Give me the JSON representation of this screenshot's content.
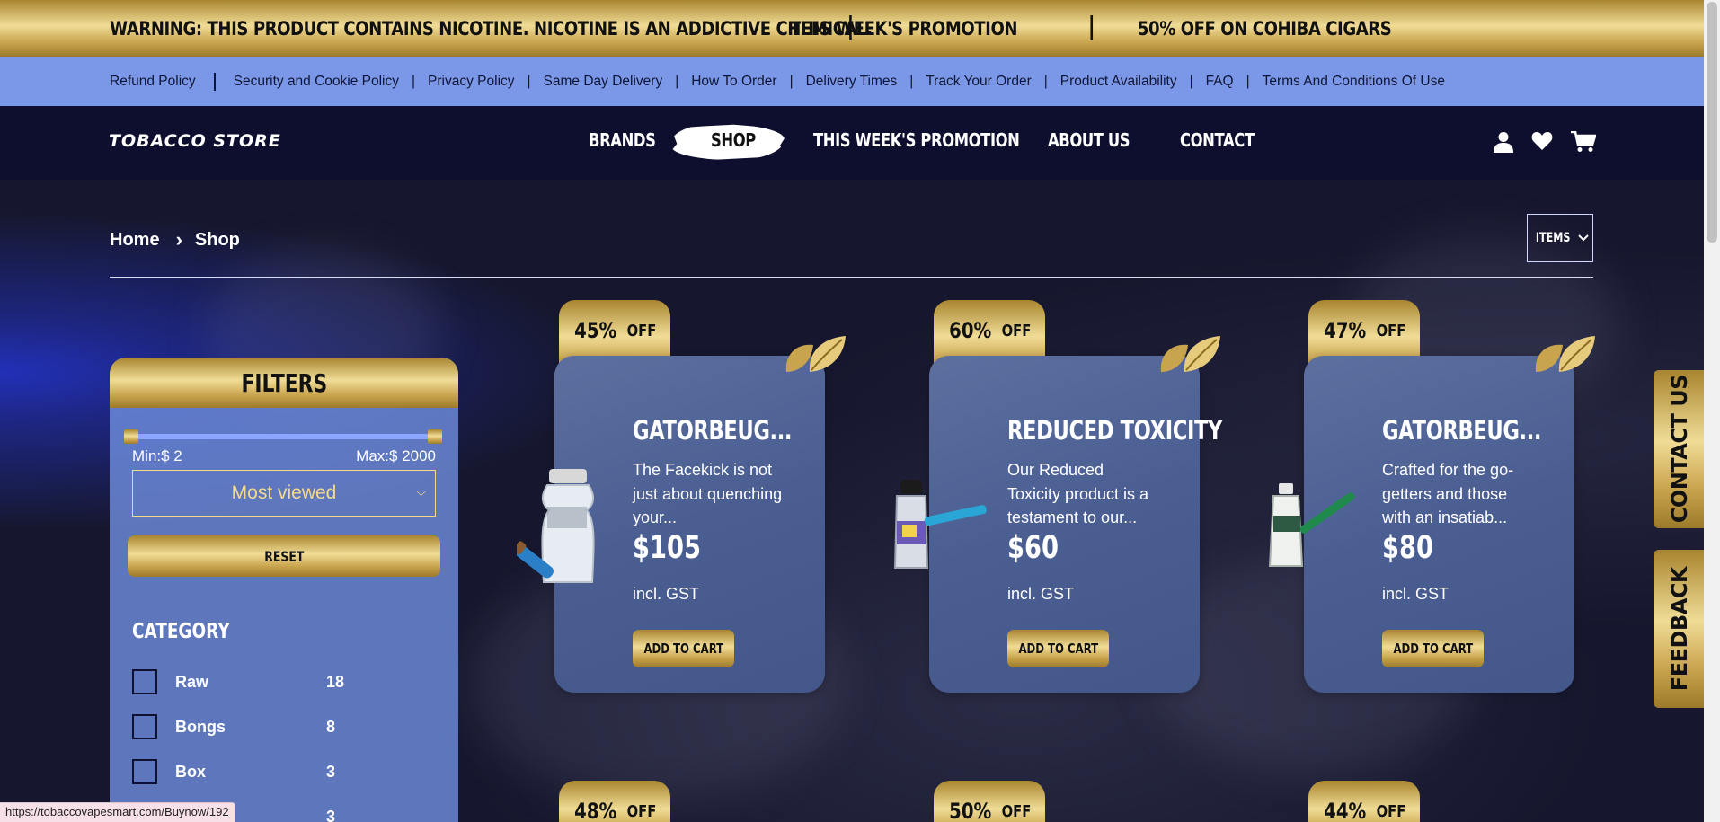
{
  "warning_bar": {
    "warning": "WARNING: THIS PRODUCT CONTAINS NICOTINE. NICOTINE IS AN ADDICTIVE CHEMICAL.",
    "promo_title": "THIS WEEK'S PROMOTION",
    "promo_offer": "50% OFF ON COHIBA CIGARS"
  },
  "top_links": [
    "Refund Policy",
    "Security and Cookie Policy",
    "Privacy Policy",
    "Same Day Delivery",
    "How To Order",
    "Delivery Times",
    "Track Your Order",
    "Product Availability",
    "FAQ",
    "Terms And Conditions Of Use"
  ],
  "nav": {
    "logo": "TOBACCO STORE",
    "items": [
      "BRANDS",
      "SHOP",
      "THIS WEEK'S PROMOTION",
      "ABOUT US",
      "CONTACT"
    ],
    "active": "SHOP",
    "icons": [
      "user-icon",
      "heart-icon",
      "cart-icon"
    ]
  },
  "breadcrumb": {
    "home": "Home",
    "current": "Shop"
  },
  "items_select": {
    "label": "ITEMS"
  },
  "filters": {
    "title": "FILTERS",
    "price_min": "Min:$ 2",
    "price_max": "Max:$ 2000",
    "sort_value": "Most viewed",
    "reset_label": "RESET",
    "category_title": "CATEGORY",
    "categories": [
      {
        "name": "Raw",
        "count": "18"
      },
      {
        "name": "Bongs",
        "count": "8"
      },
      {
        "name": "Box",
        "count": "3"
      },
      {
        "name": "",
        "count": "3"
      }
    ]
  },
  "products": [
    {
      "discount_value": "45%",
      "discount_suffix": "OFF",
      "title": "GATORBEUG...",
      "desc": "The Facekick is not just about quenching your...",
      "price": "$105",
      "gst": "incl. GST",
      "button": "ADD TO CART"
    },
    {
      "discount_value": "60%",
      "discount_suffix": "OFF",
      "title": "REDUCED TOXICITY",
      "desc": "Our Reduced Toxicity product is a testament to our...",
      "price": "$60",
      "gst": "incl. GST",
      "button": "ADD TO CART"
    },
    {
      "discount_value": "47%",
      "discount_suffix": "OFF",
      "title": "GATORBEUG...",
      "desc": "Crafted for the go-getters and those with an insatiab...",
      "price": "$80",
      "gst": "incl. GST",
      "button": "ADD TO CART"
    }
  ],
  "next_row_discounts": [
    {
      "value": "48%",
      "suffix": "OFF"
    },
    {
      "value": "50%",
      "suffix": "OFF"
    },
    {
      "value": "44%",
      "suffix": "OFF"
    }
  ],
  "side_tabs": {
    "contact": "CONTACT US",
    "feedback": "FEEDBACK"
  },
  "status_url": "https://tobaccovapesmart.com/Buynow/192",
  "colors": {
    "gold": "#d9bb6a",
    "link_bar": "#7b98e8",
    "nav_bg": "#0e0f2e",
    "card_bg": "#4a5e92"
  }
}
